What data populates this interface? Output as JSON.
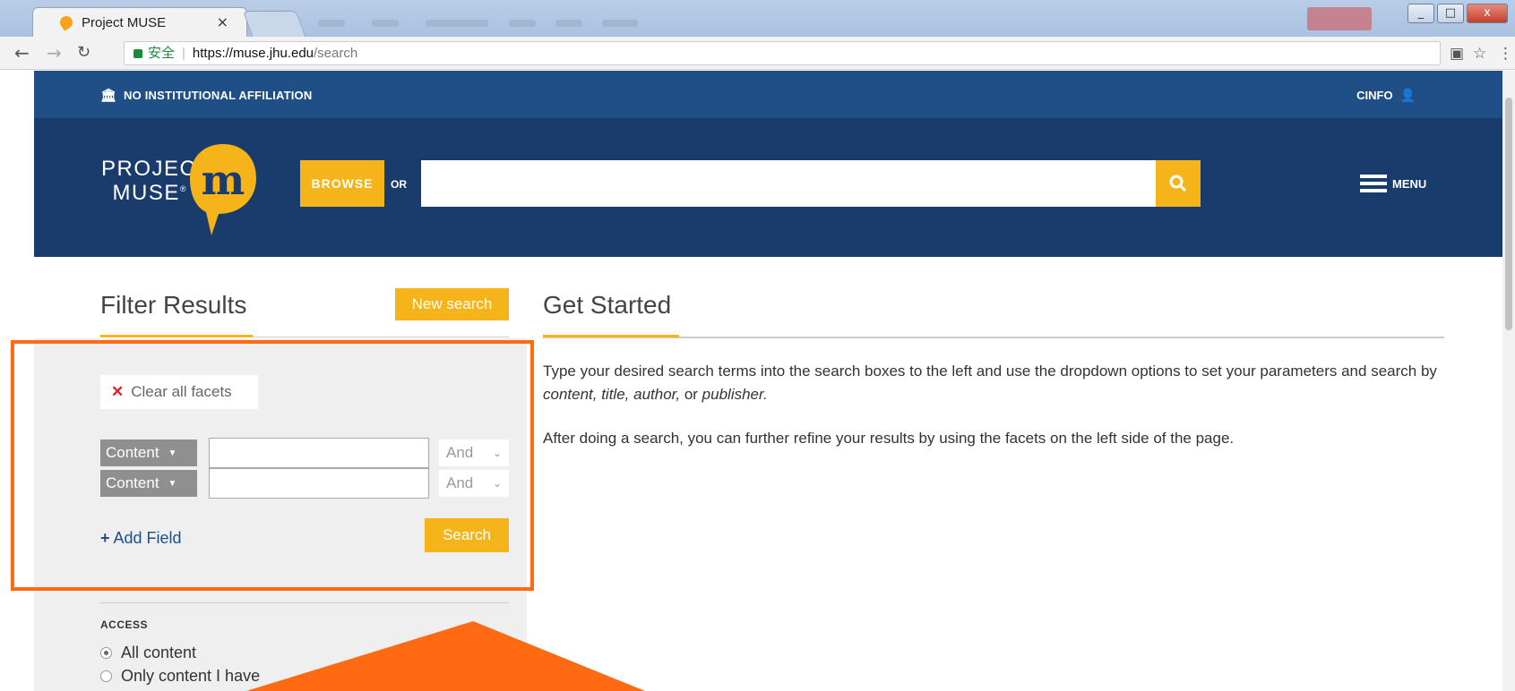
{
  "browser": {
    "tab_title": "Project MUSE",
    "tab_close": "×",
    "url_secure_label": "安全",
    "url_host": "https://muse.jhu.edu",
    "url_path": "/search",
    "window_controls": [
      "_",
      "□",
      "x"
    ]
  },
  "site": {
    "institution": "NO INSTITUTIONAL AFFILIATION",
    "user": "CINFO",
    "logo_line1": "PROJECT",
    "logo_line2": "MUSE",
    "logo_trademark": "®",
    "browse_label": "BROWSE",
    "or_label": "OR",
    "search_placeholder": "",
    "menu_label": "MENU"
  },
  "sidebar": {
    "title": "Filter Results",
    "new_search_label": "New search",
    "clear_label": "Clear all facets",
    "fields": [
      {
        "type": "Content",
        "value": "",
        "operator": "And"
      },
      {
        "type": "Content",
        "value": "",
        "operator": "And"
      }
    ],
    "add_field_label": "Add Field",
    "search_label": "Search",
    "access_heading": "ACCESS",
    "access_options": [
      {
        "label": "All content",
        "selected": true
      },
      {
        "label": "Only content I have",
        "selected": false
      }
    ]
  },
  "main": {
    "title": "Get Started",
    "p1_before": "Type your desired search terms into the search boxes to the left and use the dropdown options to set your parameters and search by ",
    "p1_em1": "content, title, author,",
    "p1_mid": " or ",
    "p1_em2": "publisher.",
    "p2": "After doing a search, you can further refine your results by using the facets on the left side of the page."
  },
  "colors": {
    "accent": "#f4b41a",
    "header_dark": "#1a3c6d",
    "header_strip": "#1f4f86",
    "annotation": "#ff6a13"
  }
}
